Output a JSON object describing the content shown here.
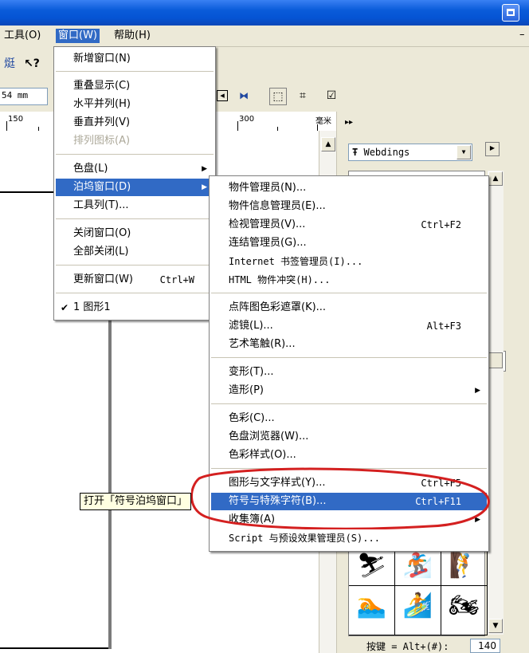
{
  "menubar": {
    "tools": "工具(O)",
    "window": "窗口(W)",
    "help": "帮助(H)"
  },
  "toolbar": {
    "units_value": "54 mm",
    "ruler_150": "150",
    "ruler_300": "300",
    "ruler_unit": "毫米"
  },
  "window_menu": {
    "items": [
      {
        "label": "新增窗口(N)"
      },
      {
        "label": "重叠显示(C)"
      },
      {
        "label": "水平并列(H)"
      },
      {
        "label": "垂直并列(V)"
      },
      {
        "label": "排列图标(A)"
      },
      {
        "label": "色盘(L)"
      },
      {
        "label": "泊坞窗口(D)"
      },
      {
        "label": "工具列(T)..."
      },
      {
        "label": "关闭窗口(O)"
      },
      {
        "label": "全部关闭(L)"
      },
      {
        "label": "更新窗口(W)",
        "shortcut": "Ctrl+W"
      },
      {
        "label": "1 图形1"
      }
    ]
  },
  "docker_menu": {
    "items": [
      {
        "label": "物件管理员(N)..."
      },
      {
        "label": "物件信息管理员(E)..."
      },
      {
        "label": "检视管理员(V)...",
        "shortcut": "Ctrl+F2"
      },
      {
        "label": "连结管理员(G)..."
      },
      {
        "label": "Internet 书签管理员(I)..."
      },
      {
        "label": "HTML 物件冲突(H)..."
      },
      {
        "label": "点阵图色彩遮罩(K)..."
      },
      {
        "label": "滤镜(L)...",
        "shortcut": "Alt+F3"
      },
      {
        "label": "艺术笔触(R)..."
      },
      {
        "label": "变形(T)..."
      },
      {
        "label": "造形(P)"
      },
      {
        "label": "色彩(C)..."
      },
      {
        "label": "色盘浏览器(W)..."
      },
      {
        "label": "色彩样式(O)..."
      },
      {
        "label": "图形与文字样式(Y)...",
        "shortcut": "Ctrl+F5"
      },
      {
        "label": "符号与特殊字符(B)...",
        "shortcut": "Ctrl+F11"
      },
      {
        "label": "收集簿(A)"
      },
      {
        "label": "Script 与预设效果管理员(S)..."
      }
    ]
  },
  "tooltip": "打开「符号泊坞窗口」",
  "symbols_docker": {
    "font": "Webdings",
    "key_label": "按键 = Alt+(#):",
    "key_value": "140"
  },
  "colors": {
    "highlight": "#316ac5",
    "annotation": "#d42020",
    "tooltip_bg": "#ffffe1"
  }
}
